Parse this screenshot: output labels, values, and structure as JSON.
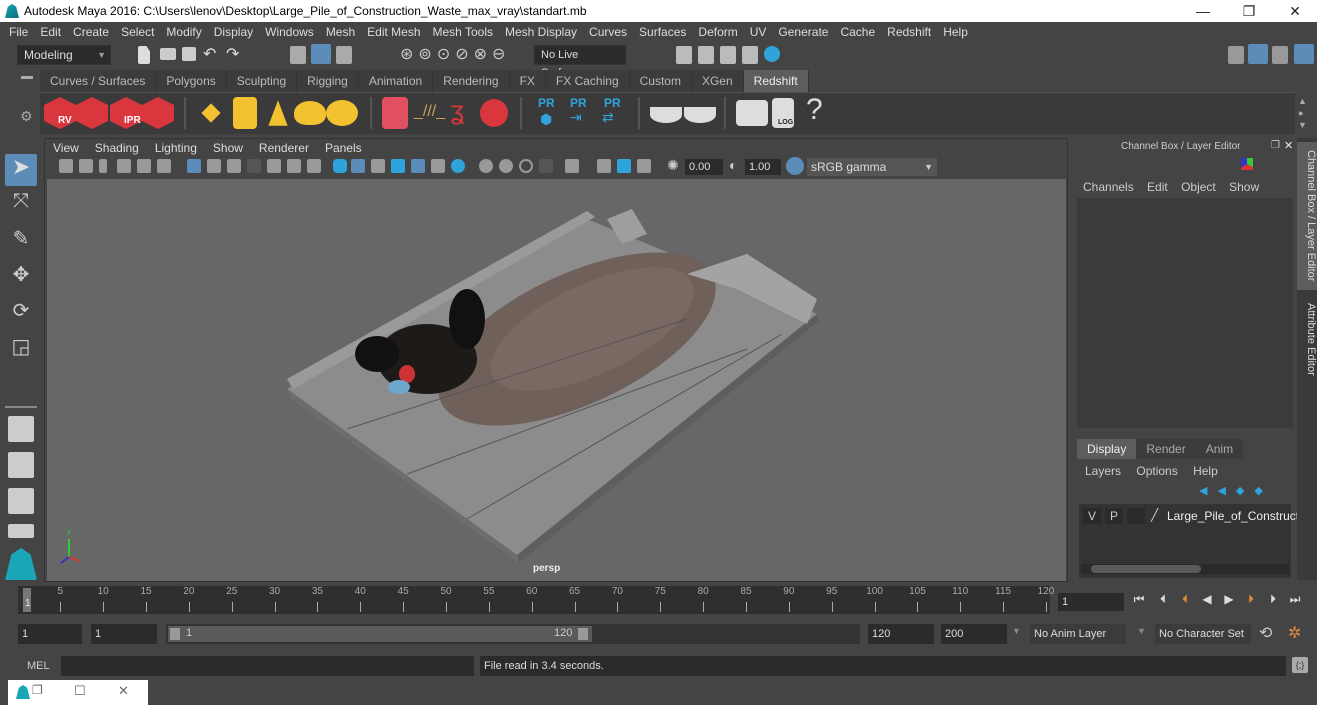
{
  "window": {
    "title": "Autodesk Maya 2016: C:\\Users\\lenov\\Desktop\\Large_Pile_of_Construction_Waste_max_vray\\standart.mb",
    "controls": {
      "minimize": "—",
      "restore": "❐",
      "close": "✕"
    }
  },
  "menubar": {
    "items": [
      "File",
      "Edit",
      "Create",
      "Select",
      "Modify",
      "Display",
      "Windows",
      "Mesh",
      "Edit Mesh",
      "Mesh Tools",
      "Mesh Display",
      "Curves",
      "Surfaces",
      "Deform",
      "UV",
      "Generate",
      "Cache",
      "Redshift",
      "Help"
    ]
  },
  "statusline": {
    "mode": "Modeling",
    "live_surface": "No Live Surface"
  },
  "shelf": {
    "tabs": [
      "Curves / Surfaces",
      "Polygons",
      "Sculpting",
      "Rigging",
      "Animation",
      "Rendering",
      "FX",
      "FX Caching",
      "Custom",
      "XGen",
      "Redshift"
    ],
    "active_tab": "Redshift",
    "icon_labels": {
      "rv": "RV",
      "ipr": "IPR",
      "pr": "PR",
      "log": "LOG",
      "help": "?"
    }
  },
  "viewport": {
    "menus": [
      "View",
      "Shading",
      "Lighting",
      "Show",
      "Renderer",
      "Panels"
    ],
    "exposure": "0.00",
    "gamma": "1.00",
    "color_space": "sRGB gamma",
    "camera_label": "persp",
    "axis": {
      "x": "x",
      "y": "y",
      "z": "z"
    }
  },
  "channel_box": {
    "title": "Channel Box / Layer Editor",
    "menus": [
      "Channels",
      "Edit",
      "Object",
      "Show"
    ]
  },
  "layer_editor": {
    "tabs": [
      "Display",
      "Render",
      "Anim"
    ],
    "active_tab": "Display",
    "menus": [
      "Layers",
      "Options",
      "Help"
    ],
    "layers": [
      {
        "visible": "V",
        "playback": "P",
        "name": "Large_Pile_of_Constructi"
      }
    ]
  },
  "side_tabs": [
    "Channel Box / Layer Editor",
    "Attribute Editor"
  ],
  "timeline": {
    "ticks": [
      1,
      5,
      10,
      15,
      20,
      25,
      30,
      35,
      40,
      45,
      50,
      55,
      60,
      65,
      70,
      75,
      80,
      85,
      90,
      95,
      100,
      105,
      110,
      115,
      120
    ],
    "range_min": 1,
    "range_max": 120,
    "current_frame": "1"
  },
  "range_slider": {
    "start": "1",
    "playback_start": "1",
    "slider_start": "1",
    "slider_end": "120",
    "playback_end": "120",
    "end": "200",
    "anim_layer": "No Anim Layer",
    "character_set": "No Character Set"
  },
  "command_line": {
    "language": "MEL",
    "input": "",
    "result": "File read in  3.4 seconds."
  },
  "colors": {
    "accent": "#5b8db8",
    "redshift_red": "#d9363e",
    "polygon_yellow": "#f2c230",
    "pr_blue": "#2fa4dc",
    "maya_teal": "#1aa6b7"
  }
}
